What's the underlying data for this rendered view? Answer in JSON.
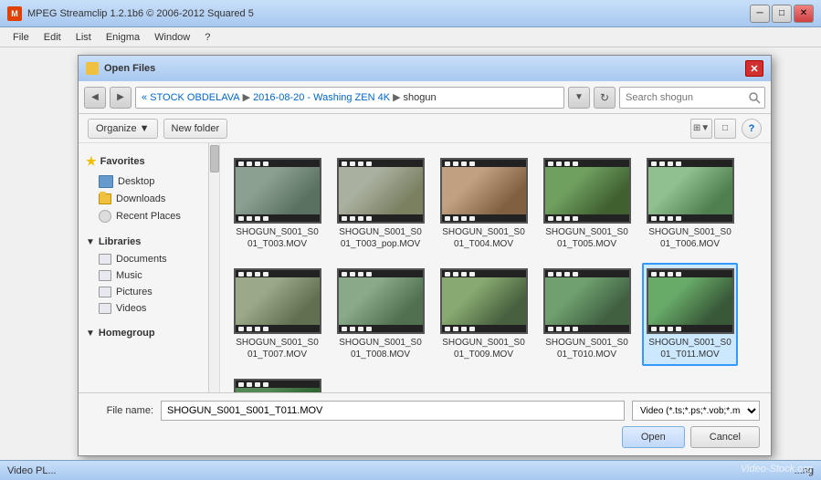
{
  "app": {
    "title": "MPEG Streamclip 1.2.1b6  © 2006-2012 Squared 5",
    "icon_label": "M"
  },
  "menu": {
    "items": [
      "File",
      "Edit",
      "List",
      "Enigma",
      "Window",
      "?"
    ]
  },
  "dialog": {
    "title": "Open Files",
    "close_btn": "✕",
    "nav_back": "◀",
    "nav_forward": "▶",
    "breadcrumb": {
      "parts": [
        "« STOCK OBDELAVA",
        "2016-08-20 - Washing ZEN 4K",
        "shogun"
      ]
    },
    "search_placeholder": "Search shogun",
    "toolbar": {
      "organize": "Organize",
      "organize_arrow": "▼",
      "new_folder": "New folder",
      "view_icon": "⊞",
      "view_list": "≡",
      "help": "?"
    },
    "sidebar": {
      "favorites_header": "Favorites",
      "items_favorites": [
        {
          "label": "Desktop",
          "icon": "desktop"
        },
        {
          "label": "Downloads",
          "icon": "downloads"
        },
        {
          "label": "Recent Places",
          "icon": "recent"
        }
      ],
      "libraries_header": "Libraries",
      "items_libraries": [
        {
          "label": "Documents",
          "icon": "docs"
        },
        {
          "label": "Music",
          "icon": "music"
        },
        {
          "label": "Pictures",
          "icon": "pictures"
        },
        {
          "label": "Videos",
          "icon": "videos"
        }
      ],
      "homegroup_header": "Homegroup"
    },
    "files": [
      {
        "name": "SHOGUN_S001_S001_T003.MOV",
        "thumb_class": "thumb-1"
      },
      {
        "name": "SHOGUN_S001_S001_T003_pop.MOV",
        "thumb_class": "thumb-2"
      },
      {
        "name": "SHOGUN_S001_S001_T004.MOV",
        "thumb_class": "thumb-3"
      },
      {
        "name": "SHOGUN_S001_S001_T005.MOV",
        "thumb_class": "thumb-4"
      },
      {
        "name": "SHOGUN_S001_S001_T006.MOV",
        "thumb_class": "thumb-5"
      },
      {
        "name": "SHOGUN_S001_S001_T007.MOV",
        "thumb_class": "thumb-6"
      },
      {
        "name": "SHOGUN_S001_S001_T008.MOV",
        "thumb_class": "thumb-7"
      },
      {
        "name": "SHOGUN_S001_S001_T009.MOV",
        "thumb_class": "thumb-8"
      },
      {
        "name": "SHOGUN_S001_S001_T010.MOV",
        "thumb_class": "thumb-9"
      },
      {
        "name": "SHOGUN_S001_S001_T011.MOV",
        "thumb_class": "thumb-10",
        "selected": true
      }
    ],
    "partial_file": {
      "name": "",
      "thumb_class": "thumb-11"
    },
    "bottom": {
      "file_name_label": "File name:",
      "file_name_value": "SHOGUN_S001_S001_T011.MOV",
      "file_type_value": "Video (*.ts;*.ps;*.vob;*.mpeg;*.",
      "open_btn": "Open",
      "cancel_btn": "Cancel"
    }
  },
  "status": {
    "left": "Video PL...",
    "right": "...ng"
  },
  "watermark": "Video-Stock.org"
}
